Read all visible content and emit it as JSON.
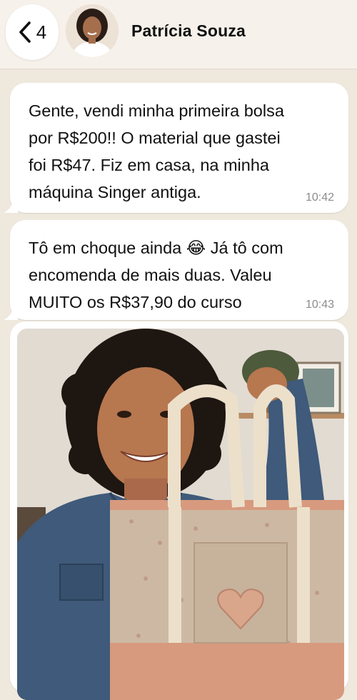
{
  "header": {
    "back_count": "4",
    "contact_name": "Patrícia Souza",
    "back_icon": "chevron-left-icon"
  },
  "messages": [
    {
      "text": "Gente, vendi minha primeira bolsa\npor R$200!! O material que gastei\nfoi R$47. Fiz em casa, na minha\nmáquina Singer antiga.",
      "time": "10:42"
    },
    {
      "text": "Tô em choque ainda 😂 Já tô com\nencomenda de mais duas. Valeu\nMUITO os R$37,90 do curso",
      "time": "10:43"
    }
  ],
  "colors": {
    "chat_background": "#efe8dd",
    "bubble": "#ffffff",
    "header": "#f6f1ea"
  }
}
